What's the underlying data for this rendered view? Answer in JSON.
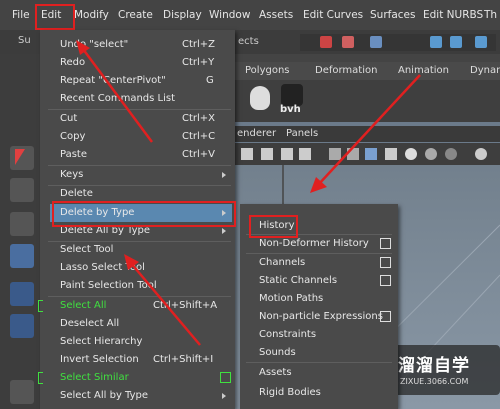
{
  "menubar": [
    "File",
    "Edit",
    "Modify",
    "Create",
    "Display",
    "Window",
    "Assets",
    "Edit Curves",
    "Surfaces",
    "Edit NURBS",
    "Th"
  ],
  "toolbar": {
    "field_left": "Su",
    "field_text": "ects"
  },
  "shelf_tabs": [
    "Polygons",
    "Deformation",
    "Animation",
    "Dynam"
  ],
  "shelf_label": "bvh",
  "viewport_menu": [
    "enderer",
    "Panels"
  ],
  "edit_menu": [
    {
      "label": "Undo \"select\"",
      "shortcut": "Ctrl+Z"
    },
    {
      "label": "Redo",
      "shortcut": "Ctrl+Y"
    },
    {
      "label": "Repeat \"CenterPivot\"",
      "shortcut": "G"
    },
    {
      "label": "Recent Commands List",
      "shortcut": ""
    },
    {
      "label": "Cut",
      "shortcut": "Ctrl+X"
    },
    {
      "label": "Copy",
      "shortcut": "Ctrl+C"
    },
    {
      "label": "Paste",
      "shortcut": "Ctrl+V"
    },
    {
      "label": "Keys",
      "shortcut": ""
    },
    {
      "label": "Delete",
      "shortcut": ""
    },
    {
      "label": "Delete by Type",
      "shortcut": ""
    },
    {
      "label": "Delete All by Type",
      "shortcut": ""
    },
    {
      "label": "Select Tool",
      "shortcut": ""
    },
    {
      "label": "Lasso Select Tool",
      "shortcut": ""
    },
    {
      "label": "Paint Selection Tool",
      "shortcut": ""
    },
    {
      "label": "Select All",
      "shortcut": "Ctrl+Shift+A"
    },
    {
      "label": "Deselect All",
      "shortcut": ""
    },
    {
      "label": "Select Hierarchy",
      "shortcut": ""
    },
    {
      "label": "Invert Selection",
      "shortcut": "Ctrl+Shift+I"
    },
    {
      "label": "Select Similar",
      "shortcut": ""
    },
    {
      "label": "Select All by Type",
      "shortcut": ""
    }
  ],
  "submenu": [
    "History",
    "Non-Deformer History",
    "Channels",
    "Static Channels",
    "Motion Paths",
    "Non-particle Expressions",
    "Constraints",
    "Sounds",
    "Assets",
    "Rigid Bodies"
  ],
  "watermark": {
    "title": "溜溜自学",
    "sub": "ZIXUE.3066.COM"
  },
  "colors": {
    "highlight": "#5a88b0",
    "annotation": "#e02020",
    "green_text": "#40e040"
  }
}
